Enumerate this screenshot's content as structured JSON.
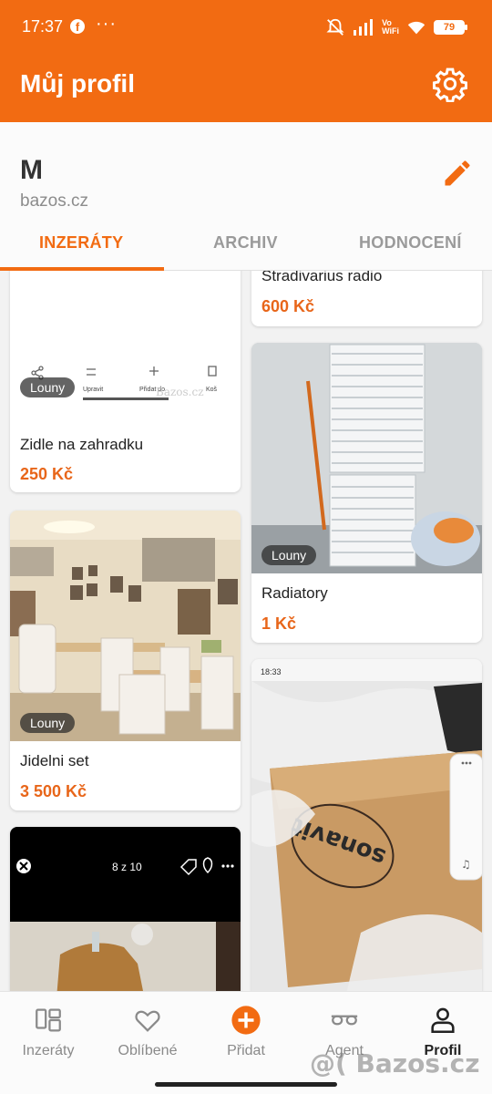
{
  "status_bar": {
    "time": "17:37",
    "dots": "···",
    "vowifi_top": "Vo",
    "vowifi_bottom": "WiFi",
    "battery": "79"
  },
  "header": {
    "title": "Můj profil"
  },
  "profile": {
    "initial": "M",
    "site": "bazos.cz"
  },
  "tabs": [
    {
      "label": "INZERÁTY",
      "active": true
    },
    {
      "label": "ARCHIV",
      "active": false
    },
    {
      "label": "HODNOCENÍ",
      "active": false
    }
  ],
  "listings": [
    {
      "title": "Zidle na zahradku",
      "price": "250 Kč",
      "location": "Louny",
      "thumb_actions": [
        "Upravit",
        "Přidat do",
        "Koš"
      ]
    },
    {
      "title": "Stradivarius radio",
      "price": "600 Kč"
    },
    {
      "title": "Radiatory",
      "price": "1 Kč",
      "location": "Louny"
    },
    {
      "title": "Jidelni set",
      "price": "3 500 Kč",
      "location": "Louny"
    },
    {
      "photo_overlay": "8 z 10"
    },
    {
      "photo_time": "18:33"
    }
  ],
  "bottom_nav": [
    {
      "label": "Inzeráty",
      "icon": "grid-icon",
      "active": false
    },
    {
      "label": "Oblíbené",
      "icon": "heart-icon",
      "active": false
    },
    {
      "label": "Přidat",
      "icon": "add-circle-icon",
      "active": false
    },
    {
      "label": "Agent",
      "icon": "glasses-icon",
      "active": false
    },
    {
      "label": "Profil",
      "icon": "person-icon",
      "active": true
    }
  ],
  "watermark": "@( Bazos.cz",
  "colors": {
    "accent": "#f26b12",
    "price": "#e8661a"
  }
}
